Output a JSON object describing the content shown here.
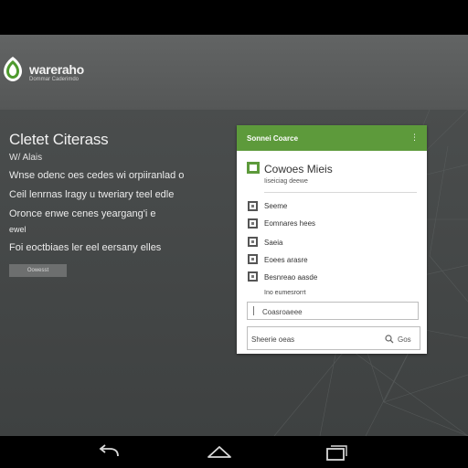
{
  "header": {
    "brand_name": "wareraho",
    "brand_tagline": "Dommar Caderimdo",
    "logo_color": "#4e9a2e"
  },
  "hero": {
    "heading": "Cletet Citerass",
    "subhead": "W/ Alais",
    "lines": [
      "Wnse odenc oes cedes wi orpiiranlad o",
      "Ceil lenrnas lragy u tweriary teel edle",
      "Oronce enwe cenes yeargang'i e",
      "ewel",
      "Foi eoctbiaes ler eel eersany elles"
    ],
    "button_label": "Oowesst"
  },
  "card": {
    "title": "Sonnei Coarce",
    "menu_icon": "more-vert-icon",
    "header_color": "#5d9a3b",
    "head_label": "Cowoes Mieis",
    "head_sub": "Iiseiciag deewe",
    "options": [
      "Seeme",
      "Eomnares hees",
      "Saeia",
      "Eoees arasre",
      "Besnreao aasde"
    ],
    "note": "Ino eumesrorrt",
    "field_value": "Coasroaeee",
    "search_placeholder": "Sheerie oeas",
    "go_label": "Gos"
  },
  "navbar": {
    "back_icon": "back-icon",
    "home_icon": "home-icon",
    "recents_icon": "recents-icon"
  }
}
